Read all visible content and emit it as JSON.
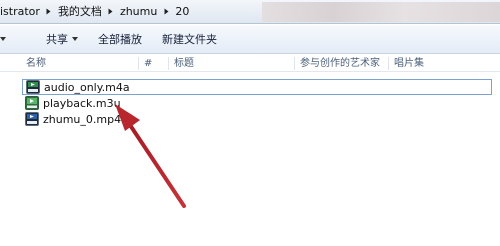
{
  "addressbar": {
    "crumbs": [
      "istrator",
      "我的文档",
      "zhumu",
      "20"
    ]
  },
  "toolbar": {
    "organize_label": "共享",
    "play_all_label": "全部播放",
    "new_folder_label": "新建文件夹"
  },
  "columns": {
    "name": "名称",
    "number": "#",
    "title": "标题",
    "artists": "参与创作的艺术家",
    "album": "唱片集"
  },
  "files": [
    {
      "name": "audio_only.m4a",
      "icon": "mpc-media-file-icon",
      "selected": true
    },
    {
      "name": "playback.m3u",
      "icon": "playlist-file-icon",
      "selected": false
    },
    {
      "name": "zhumu_0.mp4",
      "icon": "mpc-media-file-icon",
      "selected": false
    }
  ],
  "colors": {
    "annotation_arrow": "#b8262e",
    "selection_border": "#7da2ce"
  }
}
